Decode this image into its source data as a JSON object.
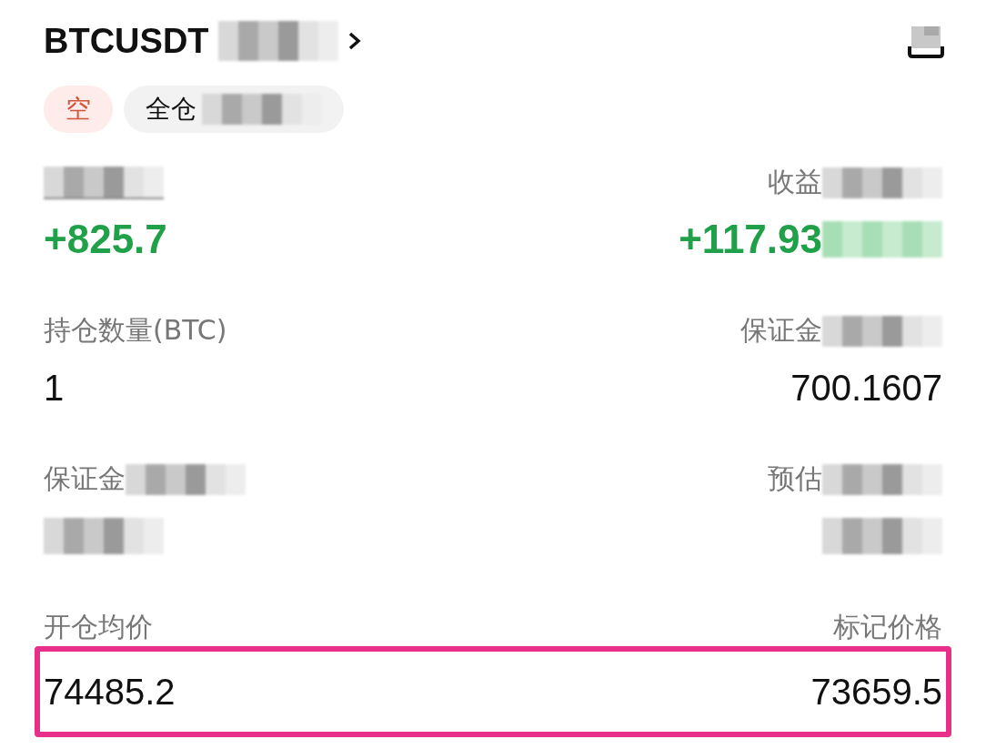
{
  "header": {
    "symbol": "BTCUSDT",
    "symbol_blurred": true,
    "tags": [
      {
        "label": "空",
        "kind": "side"
      },
      {
        "label": "全仓",
        "kind": "margin",
        "blurred": true
      }
    ]
  },
  "rows": [
    {
      "highlighted": false,
      "left": {
        "label_blurred": true,
        "underlined": true,
        "value": "+825.7",
        "color": "#20a048"
      },
      "right": {
        "label": "收益",
        "label_blurred": true,
        "value": "+117.93",
        "value_blurred": true,
        "color": "#20a048"
      }
    },
    {
      "highlighted": false,
      "left": {
        "label": "持仓数量(BTC)",
        "value": "1"
      },
      "right": {
        "label": "保证金",
        "label_blurred": true,
        "value": "700.1607"
      }
    },
    {
      "highlighted": false,
      "left": {
        "label": "保证金",
        "label_blurred": true,
        "value_blurred": true
      },
      "right": {
        "label": "预估",
        "label_blurred": true,
        "value_blurred": true
      }
    },
    {
      "highlighted": true,
      "left": {
        "label": "开仓均价",
        "value": "74485.2"
      },
      "right": {
        "label": "标记价格",
        "value": "73659.5"
      }
    }
  ]
}
